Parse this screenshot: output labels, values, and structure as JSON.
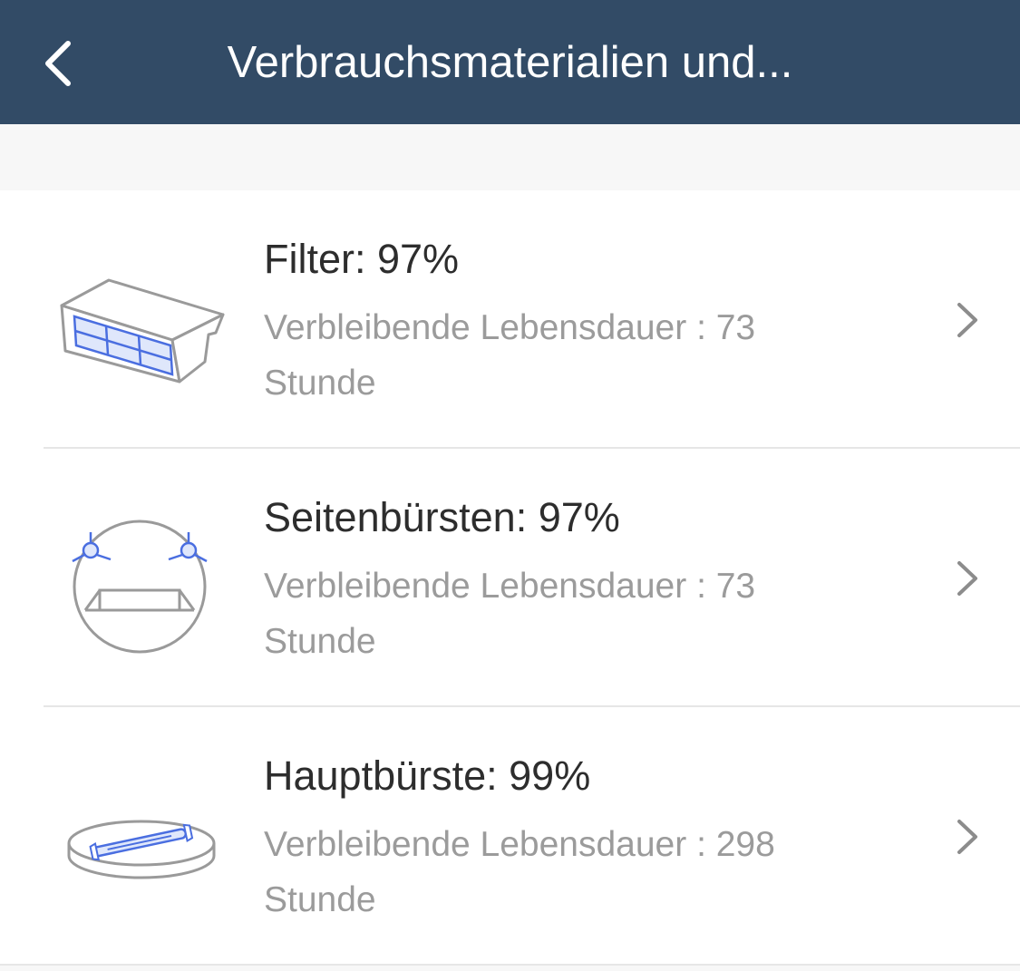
{
  "header": {
    "title": "Verbrauchsmaterialien und..."
  },
  "items": [
    {
      "title": "Filter: 97%",
      "subtitle_line1": "Verbleibende Lebensdauer : 73",
      "subtitle_line2": "Stunde",
      "icon": "filter-icon"
    },
    {
      "title": "Seitenbürsten: 97%",
      "subtitle_line1": "Verbleibende Lebensdauer : 73",
      "subtitle_line2": "Stunde",
      "icon": "side-brush-icon"
    },
    {
      "title": "Hauptbürste: 99%",
      "subtitle_line1": "Verbleibende Lebensdauer : 298",
      "subtitle_line2": "Stunde",
      "icon": "main-brush-icon"
    }
  ],
  "colors": {
    "navbar": "#324b66",
    "accent_blue": "#4a6ee0",
    "outline_gray": "#9a9a9a"
  }
}
